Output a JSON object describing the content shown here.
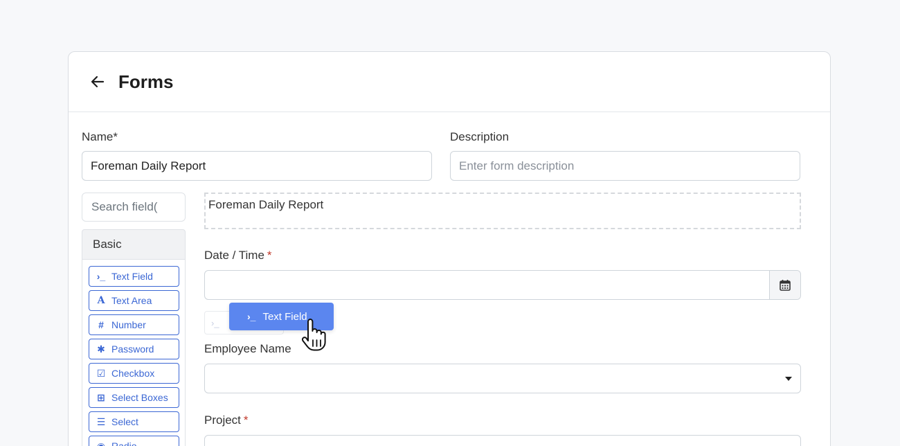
{
  "header": {
    "title": "Forms",
    "back_icon": "arrow-left-icon"
  },
  "form_meta": {
    "name_label": "Name*",
    "name_value": "Foreman Daily Report",
    "description_label": "Description",
    "description_placeholder": "Enter form description"
  },
  "sidebar": {
    "search_placeholder": "Search field(",
    "group_title": "Basic",
    "components": [
      {
        "label": "Text Field",
        "icon": "terminal-icon",
        "glyph": "›_"
      },
      {
        "label": "Text Area",
        "icon": "font-icon",
        "glyph": "A"
      },
      {
        "label": "Number",
        "icon": "hashtag-icon",
        "glyph": "#"
      },
      {
        "label": "Password",
        "icon": "asterisk-icon",
        "glyph": "✱"
      },
      {
        "label": "Checkbox",
        "icon": "check-square-icon",
        "glyph": "☑"
      },
      {
        "label": "Select Boxes",
        "icon": "plus-square-icon",
        "glyph": "⊞"
      },
      {
        "label": "Select",
        "icon": "list-icon",
        "glyph": "☰"
      },
      {
        "label": "Radio",
        "icon": "dot-circle-icon",
        "glyph": "◉"
      }
    ]
  },
  "canvas": {
    "title_box_text": "Foreman Daily Report",
    "date_label": "Date / Time",
    "date_required": "*",
    "calendar_icon": "calendar-icon",
    "drag_ghost_label": "Text Field",
    "drag_ghost_glyph": "›_",
    "placeholder_glyph": "›_",
    "employee_label": "Employee Name",
    "project_label": "Project",
    "project_required": "*"
  },
  "colors": {
    "accent": "#3b67d4",
    "drag_ghost": "#5b86ef",
    "required": "#c0392b"
  }
}
